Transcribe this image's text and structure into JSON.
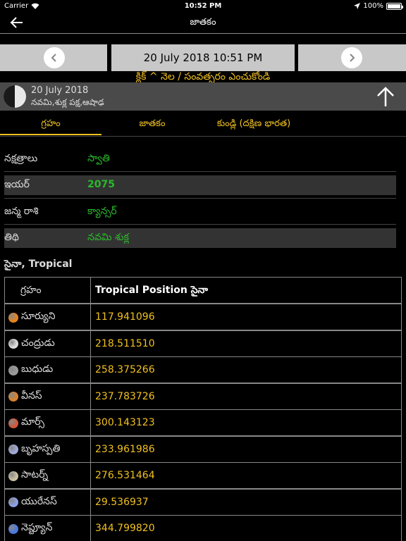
{
  "status": {
    "carrier": "Carrier",
    "time": "10:52 PM",
    "battery": "100%",
    "battery_level": 1.0
  },
  "nav": {
    "title": "జాతకం"
  },
  "date_selector": {
    "date_text": "20 July 2018 10:51 PM",
    "hint": "క్లిక్ ^ నెల / సంవత్సరం ఎంచుకోండి"
  },
  "moon": {
    "date": "20 July 2018",
    "details": "నవమి,శుక్ల పక్ష,ఆషాఢ"
  },
  "tabs": [
    "గ్రహం",
    "జాతకం",
    "కుండ్లి (దక్షిణ భారత)"
  ],
  "info": [
    {
      "label": "నక్షత్రాలు",
      "value": "స్వాతి"
    },
    {
      "label": "ఇయర్",
      "value": "2075"
    },
    {
      "label": "జన్మ రాశి",
      "value": "క్యాన్సర్"
    },
    {
      "label": "తిథి",
      "value": "నవమి శుక్ల"
    }
  ],
  "section_title": "సైనా, Tropical",
  "table": {
    "headers": [
      "గ్రహం",
      "Tropical Position సైనా"
    ],
    "rows": [
      {
        "planet": "సూర్యుని",
        "position": "117.941096",
        "color": "#e8841a"
      },
      {
        "planet": "చంద్రుడు",
        "position": "218.511510",
        "color": "#dcdcdc"
      },
      {
        "planet": "బుధుడు",
        "position": "258.375266",
        "color": "#9a9a9a"
      },
      {
        "planet": "వీనస్",
        "position": "237.783726",
        "color": "#d9822b"
      },
      {
        "planet": "మార్స్",
        "position": "300.143123",
        "color": "#d0583a"
      },
      {
        "planet": "బృహస్పతి",
        "position": "233.961986",
        "color": "#a0a8d8"
      },
      {
        "planet": "సాటర్న్",
        "position": "276.531464",
        "color": "#c8c0a0"
      },
      {
        "planet": "యురేనస్",
        "position": "29.536937",
        "color": "#8aa0e8"
      },
      {
        "planet": "నెప్ట్యూన్",
        "position": "344.799820",
        "color": "#4a78e0"
      }
    ]
  }
}
